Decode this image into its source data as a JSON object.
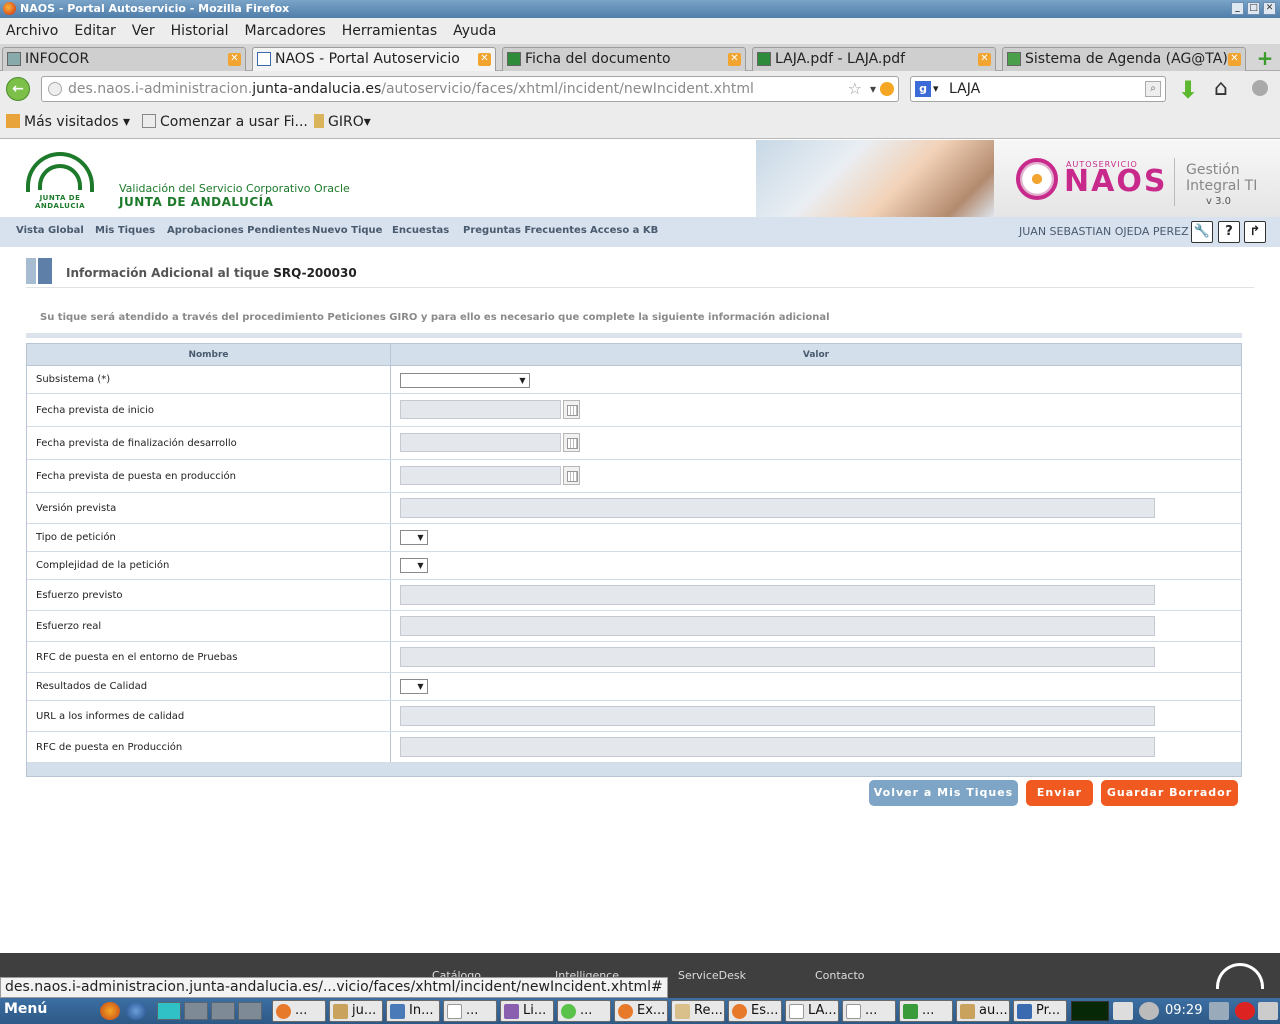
{
  "window": {
    "title": "NAOS - Portal Autoservicio - Mozilla Firefox",
    "buttons": [
      "_",
      "□",
      "✕"
    ]
  },
  "menubar": [
    "Archivo",
    "Editar",
    "Ver",
    "Historial",
    "Marcadores",
    "Herramientas",
    "Ayuda"
  ],
  "tabs": [
    {
      "label": "INFOCOR"
    },
    {
      "label": "NAOS - Portal Autoservicio"
    },
    {
      "label": "Ficha del documento"
    },
    {
      "label": "LAJA.pdf - LAJA.pdf"
    },
    {
      "label": "Sistema de Agenda (AG@TA)"
    }
  ],
  "nav": {
    "url_prefix": "des.naos.i-administracion.",
    "url_domain": "junta-andalucia.es",
    "url_path": "/autoservicio/faces/xhtml/incident/newIncident.xhtml",
    "search_value": "LAJA"
  },
  "bookmarks": [
    {
      "label": "Más visitados"
    },
    {
      "label": "Comenzar a usar Fi..."
    },
    {
      "label": "GIRO"
    }
  ],
  "header": {
    "org_logo_text": "JUNTA DE ANDALUCIA",
    "org_sub": "Validación del Servicio Corporativo Oracle",
    "org_name": "JUNTA DE ANDALUCÍA",
    "brand_small": "AUTOSERVICIO",
    "brand": "NAOS",
    "product": "Gestión Integral TI",
    "version": "v 3.0"
  },
  "appnav": {
    "items": [
      "Vista Global",
      "Mis Tiques",
      "Aprobaciones Pendientes",
      "Nuevo Tique",
      "Encuestas",
      "Preguntas Frecuentes",
      "Acceso a KB"
    ],
    "user": "JUAN SEBASTIAN OJEDA PEREZ",
    "icons": [
      "🔧",
      "?",
      "↱"
    ]
  },
  "main": {
    "title_prefix": "Información Adicional al tique",
    "ticket": "SRQ-200030",
    "info": "Su tique será atendido a través del procedimiento Peticiones GIRO y para ello es necesario que complete la siguiente información adicional",
    "col_name": "Nombre",
    "col_value": "Valor",
    "rows": [
      {
        "label": "Subsistema (*)"
      },
      {
        "label": "Fecha prevista de inicio"
      },
      {
        "label": "Fecha prevista de finalización desarrollo"
      },
      {
        "label": "Fecha prevista de puesta en producción"
      },
      {
        "label": "Versión prevista"
      },
      {
        "label": "Tipo de petición"
      },
      {
        "label": "Complejidad de la petición"
      },
      {
        "label": "Esfuerzo previsto"
      },
      {
        "label": "Esfuerzo real"
      },
      {
        "label": "RFC de puesta en el entorno de Pruebas"
      },
      {
        "label": "Resultados de Calidad"
      },
      {
        "label": "URL a los informes de calidad"
      },
      {
        "label": "RFC de puesta en Producción"
      }
    ],
    "buttons": {
      "back": "Volver a Mis Tiques",
      "send": "Enviar",
      "save": "Guardar Borrador"
    }
  },
  "footer": {
    "items": [
      "Catálogo",
      "Intelligence",
      "ServiceDesk",
      "Contacto"
    ],
    "status_url": "des.naos.i-administracion.junta-andalucia.es/...vicio/faces/xhtml/incident/newIncident.xhtml#"
  },
  "taskbar": {
    "menu": "Menú",
    "buttons": [
      "...",
      "ju...",
      "In...",
      "...",
      "Li...",
      "...",
      "Ex...",
      "Re...",
      "Es...",
      "LA...",
      "...",
      "...",
      "au...",
      "Pr..."
    ],
    "clock": "09:29"
  }
}
